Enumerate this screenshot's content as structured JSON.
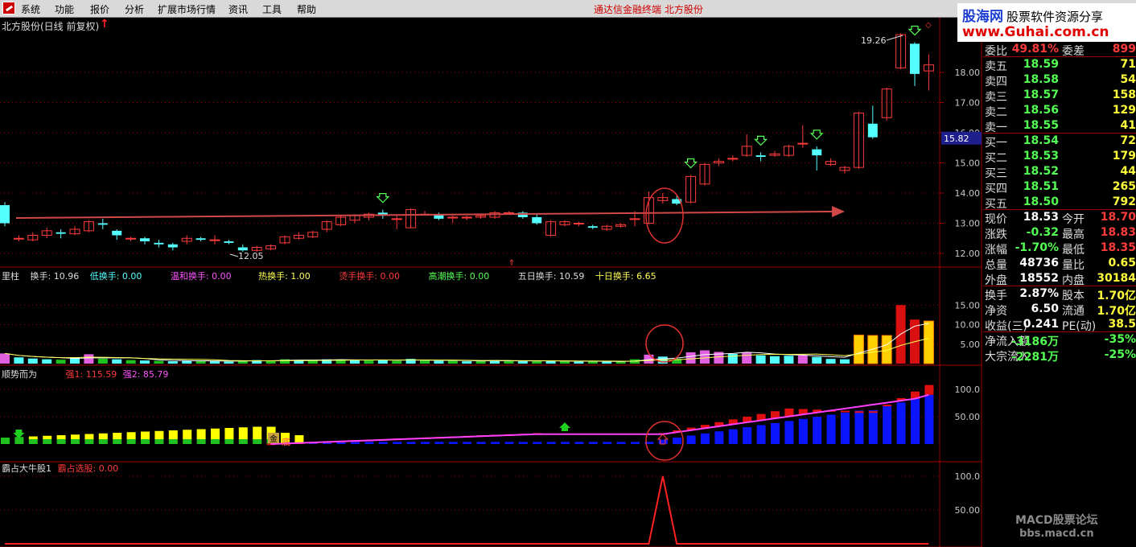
{
  "menubar": {
    "items": [
      "系统",
      "功能",
      "报价",
      "分析",
      "扩展市场行情",
      "资讯",
      "工具",
      "帮助"
    ],
    "title": "通达信金融终端    北方股份"
  },
  "watermark_top": {
    "brand": "股海网",
    "tagline": "股票软件资源分享",
    "url": "www.Guhai.com.cn"
  },
  "watermark_bottom": {
    "line1": "MACD股票论坛",
    "line2": "bbs.macd.cn"
  },
  "stock_title": "北方股份(日线 前复权)",
  "price_pane": {
    "axis_ticks": [
      "18.00",
      "17.00",
      "16.00",
      "15.00",
      "14.00",
      "13.00",
      "12.00"
    ],
    "high_label": "19.26",
    "low_label": "12.05",
    "current_marker": "15.82",
    "candles": [
      [
        13.6,
        13.0,
        13.7,
        12.9
      ],
      [
        12.5,
        12.5,
        12.6,
        12.4
      ],
      [
        12.45,
        12.6,
        12.7,
        12.4
      ],
      [
        12.6,
        12.75,
        12.85,
        12.5
      ],
      [
        12.7,
        12.65,
        12.8,
        12.5
      ],
      [
        12.65,
        12.8,
        12.9,
        12.6
      ],
      [
        12.75,
        13.05,
        13.1,
        12.7
      ],
      [
        13.0,
        12.95,
        13.15,
        12.8
      ],
      [
        12.75,
        12.6,
        12.8,
        12.45
      ],
      [
        12.5,
        12.5,
        12.55,
        12.4
      ],
      [
        12.5,
        12.4,
        12.55,
        12.3
      ],
      [
        12.35,
        12.3,
        12.45,
        12.2
      ],
      [
        12.3,
        12.2,
        12.35,
        12.1
      ],
      [
        12.4,
        12.5,
        12.6,
        12.3
      ],
      [
        12.5,
        12.45,
        12.55,
        12.4
      ],
      [
        12.45,
        12.45,
        12.6,
        12.3
      ],
      [
        12.4,
        12.35,
        12.45,
        12.3
      ],
      [
        12.2,
        12.1,
        12.3,
        12.05
      ],
      [
        12.1,
        12.2,
        12.25,
        12.05
      ],
      [
        12.15,
        12.25,
        12.3,
        12.1
      ],
      [
        12.35,
        12.55,
        12.6,
        12.3
      ],
      [
        12.5,
        12.6,
        12.7,
        12.45
      ],
      [
        12.55,
        12.7,
        12.75,
        12.5
      ],
      [
        12.8,
        13.05,
        13.1,
        12.7
      ],
      [
        12.95,
        13.2,
        13.25,
        12.9
      ],
      [
        13.1,
        13.25,
        13.3,
        13.0
      ],
      [
        13.2,
        13.3,
        13.35,
        13.1
      ],
      [
        13.35,
        13.25,
        13.45,
        13.15
      ],
      [
        13.15,
        13.15,
        13.25,
        12.8
      ],
      [
        12.85,
        13.45,
        13.5,
        12.85
      ],
      [
        13.3,
        13.3,
        13.4,
        13.25
      ],
      [
        13.3,
        13.15,
        13.35,
        13.1
      ],
      [
        13.2,
        13.2,
        13.25,
        13.0
      ],
      [
        13.2,
        13.2,
        13.25,
        13.1
      ],
      [
        13.2,
        13.25,
        13.3,
        13.15
      ],
      [
        13.2,
        13.35,
        13.4,
        13.15
      ],
      [
        13.35,
        13.35,
        13.4,
        13.3
      ],
      [
        13.35,
        13.2,
        13.4,
        13.15
      ],
      [
        13.2,
        13.0,
        13.3,
        12.95
      ],
      [
        12.6,
        13.05,
        13.1,
        12.55
      ],
      [
        12.95,
        13.05,
        13.1,
        12.9
      ],
      [
        13.0,
        13.0,
        13.05,
        12.9
      ],
      [
        12.9,
        12.85,
        12.95,
        12.8
      ],
      [
        12.8,
        12.9,
        12.95,
        12.75
      ],
      [
        12.9,
        12.95,
        13.0,
        12.85
      ],
      [
        13.15,
        13.15,
        13.4,
        12.9
      ],
      [
        13.0,
        13.85,
        14.05,
        12.95
      ],
      [
        13.75,
        13.85,
        14.0,
        13.65
      ],
      [
        13.8,
        13.65,
        13.95,
        13.6
      ],
      [
        13.7,
        14.55,
        14.6,
        13.65
      ],
      [
        14.3,
        14.95,
        15.0,
        14.25
      ],
      [
        15.0,
        15.05,
        15.15,
        14.9
      ],
      [
        15.15,
        15.15,
        15.25,
        15.05
      ],
      [
        15.25,
        15.55,
        15.95,
        15.2
      ],
      [
        15.25,
        15.2,
        15.35,
        15.05
      ],
      [
        15.25,
        15.3,
        15.4,
        15.2
      ],
      [
        15.25,
        15.55,
        15.6,
        15.2
      ],
      [
        15.65,
        15.65,
        16.25,
        15.5
      ],
      [
        15.45,
        15.25,
        15.55,
        14.75
      ],
      [
        14.95,
        15.05,
        15.15,
        14.9
      ],
      [
        14.75,
        14.85,
        14.9,
        14.65
      ],
      [
        14.85,
        16.65,
        16.7,
        14.8
      ],
      [
        16.3,
        15.85,
        16.9,
        15.8
      ],
      [
        16.5,
        17.45,
        17.5,
        16.4
      ],
      [
        18.15,
        19.25,
        19.3,
        18.1
      ],
      [
        18.95,
        17.95,
        19.0,
        17.55
      ],
      [
        18.05,
        18.25,
        18.6,
        17.4
      ]
    ],
    "arrows_down": [
      27,
      49,
      54,
      58,
      65
    ],
    "up_arrow_glyph": "↑"
  },
  "turnover_pane": {
    "labels": {
      "name": "里柱",
      "turnover": "换手: 10.96",
      "low": "低换手: 0.00",
      "mild": "温和换手: 0.00",
      "hot": "热换手: 1.00",
      "scald": "烫手换手: 0.00",
      "climax": "高潮换手: 0.00",
      "ma5": "五日换手: 10.59",
      "ma10": "十日换手: 6.65"
    },
    "axis_ticks": [
      "15.00",
      "10.00",
      "5.00"
    ],
    "values": [
      2.6,
      1.6,
      1.3,
      1.1,
      1.0,
      1.6,
      2.4,
      1.3,
      1.1,
      0.9,
      0.8,
      0.7,
      0.6,
      0.8,
      0.7,
      0.6,
      0.5,
      0.8,
      0.9,
      0.8,
      1.1,
      0.9,
      0.8,
      1.1,
      1.1,
      0.9,
      0.8,
      0.9,
      0.7,
      1.2,
      0.8,
      0.7,
      0.7,
      0.6,
      0.7,
      0.9,
      0.7,
      0.6,
      0.6,
      0.8,
      0.6,
      0.5,
      0.6,
      0.5,
      0.5,
      1.1,
      2.3,
      1.8,
      1.2,
      2.9,
      3.4,
      3.0,
      2.5,
      2.8,
      2.1,
      1.9,
      2.0,
      2.1,
      1.7,
      1.2,
      1.1,
      7.3,
      7.2,
      7.2,
      15.0,
      11.3,
      10.9
    ],
    "colors": [
      "m",
      "c",
      "c",
      "c",
      "g",
      "c",
      "m",
      "g",
      "c",
      "g",
      "c",
      "g",
      "c",
      "c",
      "g",
      "c",
      "c",
      "g",
      "c",
      "g",
      "g",
      "c",
      "g",
      "c",
      "g",
      "c",
      "g",
      "c",
      "g",
      "c",
      "g",
      "c",
      "g",
      "c",
      "g",
      "c",
      "g",
      "c",
      "g",
      "c",
      "g",
      "c",
      "g",
      "c",
      "g",
      "g",
      "m",
      "c",
      "g",
      "m",
      "m",
      "m",
      "c",
      "m",
      "c",
      "c",
      "c",
      "m",
      "c",
      "c",
      "c",
      "y",
      "y",
      "y",
      "r",
      "r",
      "y"
    ]
  },
  "trend_pane": {
    "labels": {
      "name": "顺势而为",
      "strong1": "强1: 115.59",
      "strong2": "强2: 85.79"
    },
    "axis_ticks": [
      "100.0",
      "50.00"
    ],
    "gold_tag": "金",
    "gold_text": "底"
  },
  "bull_pane": {
    "labels": {
      "name": "霸占大牛股1",
      "pick": "霸占选股: 0.00"
    },
    "axis_ticks": [
      "100.0",
      "50.00"
    ]
  },
  "side_panel": {
    "rows": [
      {
        "label": "委比",
        "v1": "49.81%",
        "label2": "委差",
        "v2": "899"
      },
      {
        "label": "卖五",
        "v1": "18.59",
        "v2": "71"
      },
      {
        "label": "卖四",
        "v1": "18.58",
        "v2": "54"
      },
      {
        "label": "卖三",
        "v1": "18.57",
        "v2": "158"
      },
      {
        "label": "卖二",
        "v1": "18.56",
        "v2": "129"
      },
      {
        "label": "卖一",
        "v1": "18.55",
        "v2": "41"
      },
      {
        "label": "买一",
        "v1": "18.54",
        "v2": "72"
      },
      {
        "label": "买二",
        "v1": "18.53",
        "v2": "179"
      },
      {
        "label": "买三",
        "v1": "18.52",
        "v2": "44"
      },
      {
        "label": "买四",
        "v1": "18.51",
        "v2": "265"
      },
      {
        "label": "买五",
        "v1": "18.50",
        "v2": "792"
      },
      {
        "label": "现价",
        "v1": "18.53",
        "label2": "今开",
        "v2": "18.70"
      },
      {
        "label": "涨跌",
        "v1": "-0.32",
        "label2": "最高",
        "v2": "18.83"
      },
      {
        "label": "涨幅",
        "v1": "-1.70%",
        "label2": "最低",
        "v2": "18.35"
      },
      {
        "label": "总量",
        "v1": "48736",
        "label2": "量比",
        "v2": "0.65"
      },
      {
        "label": "外盘",
        "v1": "18552",
        "label2": "内盘",
        "v2": "30184"
      },
      {
        "label": "换手",
        "v1": "2.87%",
        "label2": "股本",
        "v2": "1.70亿"
      },
      {
        "label": "净资",
        "v1": "6.50",
        "label2": "流通",
        "v2": "1.70亿"
      },
      {
        "label": "收益(三)",
        "v1": "0.241",
        "label2": "PE(动)",
        "v2": "38.5"
      },
      {
        "label": "净流入额",
        "v1": "-3186万",
        "v2": "-35%"
      },
      {
        "label": "大宗流入",
        "v1": "-2281万",
        "v2": "-25%"
      }
    ]
  },
  "colors": {
    "up": "#ff3b3b",
    "down": "#54ffff",
    "grid": "#a00000",
    "axis_text": "#c8c8c8",
    "magenta": "#ff00ff",
    "yellow": "#ffff00",
    "blue": "#0a14ff"
  }
}
